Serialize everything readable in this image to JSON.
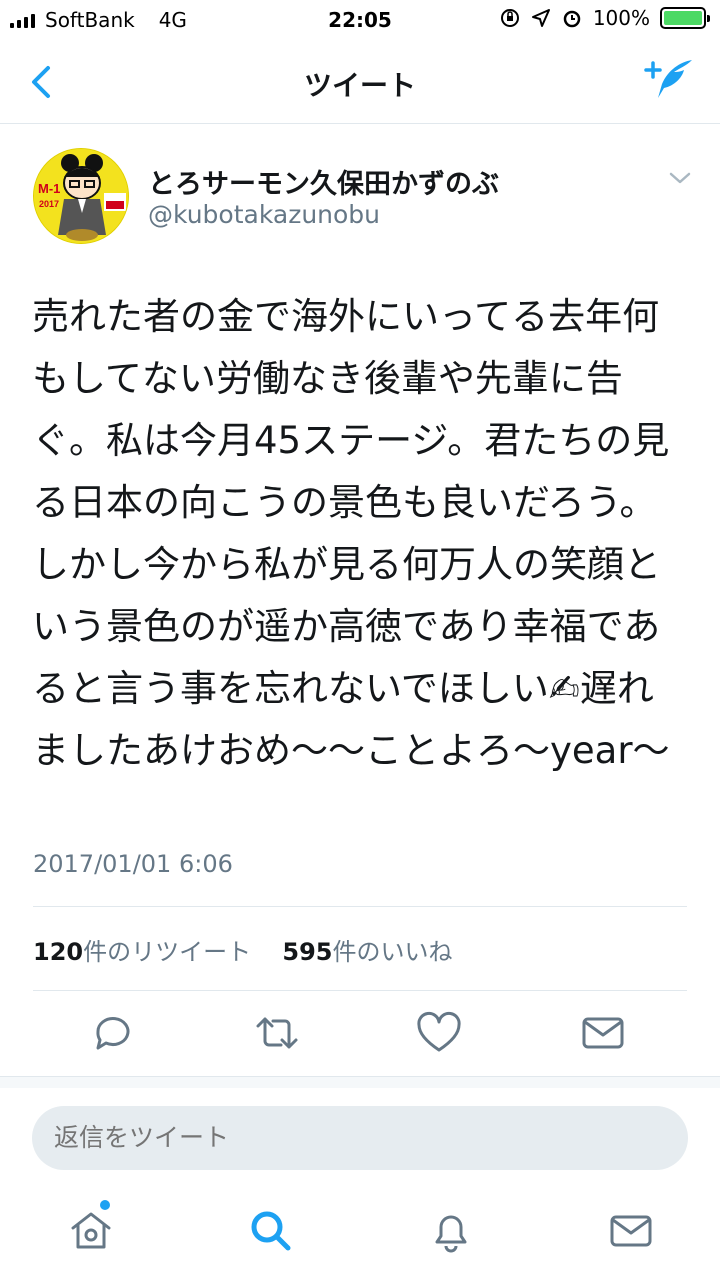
{
  "status_bar": {
    "carrier": "SoftBank",
    "network": "4G",
    "time": "22:05",
    "battery": "100%",
    "battery_level": 1.0
  },
  "nav": {
    "title": "ツイート",
    "back_icon": "chevron-left-icon",
    "compose_icon": "compose-tweet-icon"
  },
  "tweet": {
    "avatar_alt": "profile-avatar",
    "display_name": "とろサーモン久保田かずのぶ",
    "handle": "@kubotakazunobu",
    "text": "売れた者の金で海外にいってる去年何もしてない労働なき後輩や先輩に告ぐ。私は今月45ステージ。君たちの見る日本の向こうの景色も良いだろう。しかし今から私が見る何万人の笑顔という景色のが遥か高徳であり幸福であると言う事を忘れないでほしい✍遅れましたあけおめ〜〜ことよろ〜year〜",
    "timestamp": "2017/01/01 6:06",
    "retweet_count": "120",
    "retweet_label": "件のリツイート",
    "like_count": "595",
    "like_label": "件のいいね"
  },
  "actions": [
    "reply-icon",
    "retweet-icon",
    "like-icon",
    "direct-message-icon"
  ],
  "reply": {
    "placeholder": "返信をツイート"
  },
  "tab_bar": [
    "home-icon",
    "search-icon",
    "notifications-icon",
    "messages-icon"
  ],
  "colors": {
    "accent": "#1da1f2",
    "text": "#14171a",
    "secondary": "#657786"
  }
}
